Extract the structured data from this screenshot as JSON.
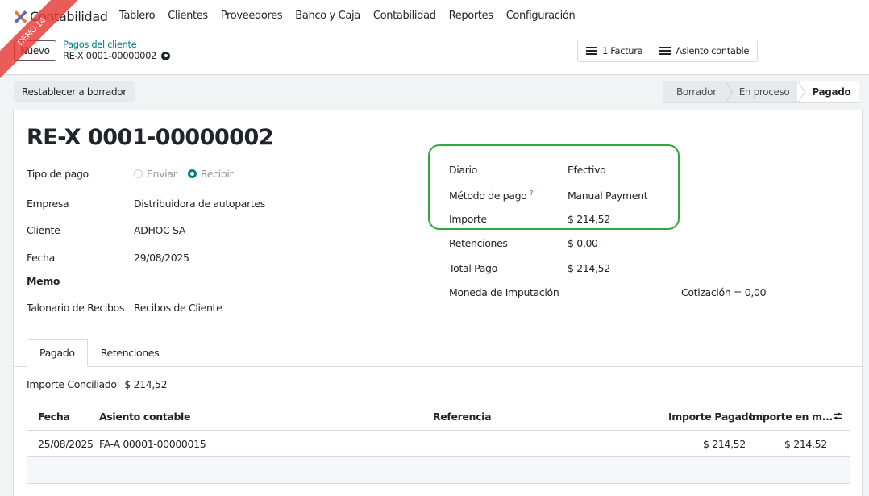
{
  "nav": {
    "app_name": "Contabilidad",
    "menu": [
      "Tablero",
      "Clientes",
      "Proveedores",
      "Banco y Caja",
      "Contabilidad",
      "Reportes",
      "Configuración"
    ],
    "ribbon": "DEMO 14"
  },
  "control": {
    "new_label": "Nuevo",
    "breadcrumb_parent": "Pagos del cliente",
    "breadcrumb_current": "RE-X 0001-00000002",
    "invoice_btn": "1 Factura",
    "entry_btn": "Asiento contable"
  },
  "statusbar": {
    "reset_label": "Restablecer a borrador",
    "steps": [
      "Borrador",
      "En proceso",
      "Pagado"
    ],
    "active_step": "Pagado"
  },
  "form": {
    "title": "RE-X 0001-00000002",
    "left": {
      "tipo_pago_label": "Tipo de pago",
      "tipo_pago_options": [
        "Enviar",
        "Recibir"
      ],
      "tipo_pago_selected": "Recibir",
      "empresa_label": "Empresa",
      "empresa_value": "Distribuidora de autopartes",
      "cliente_label": "Cliente",
      "cliente_value": "ADHOC SA",
      "fecha_label": "Fecha",
      "fecha_value": "29/08/2025",
      "memo_label": "Memo",
      "talonario_label": "Talonario de Recibos",
      "talonario_value": "Recibos de Cliente"
    },
    "right": {
      "diario_label": "Diario",
      "diario_value": "Efectivo",
      "metodo_label": "Método de pago",
      "metodo_help": "?",
      "metodo_value": "Manual Payment",
      "importe_label": "Importe",
      "importe_value": "$ 214,52",
      "retenciones_label": "Retenciones",
      "retenciones_value": "$ 0,00",
      "total_label": "Total Pago",
      "total_value": "$ 214,52",
      "moneda_label": "Moneda de Imputación",
      "cotizacion": "Cotización = 0,00"
    }
  },
  "tabs": [
    "Pagado",
    "Retenciones"
  ],
  "tab_active": "Pagado",
  "conciliado": {
    "label": "Importe Conciliado",
    "value": "$ 214,52"
  },
  "table": {
    "headers": [
      "Fecha",
      "Asiento contable",
      "Referencia",
      "Importe Pagado",
      "Importe en m..."
    ],
    "rows": [
      [
        "25/08/2025",
        "FA-A 00001-00000015",
        "",
        "$ 214,52",
        "$ 214,52"
      ]
    ]
  },
  "colors": {
    "accent": "#017e84",
    "brand": "#714b67",
    "highlight": "#2eaa3a",
    "ribbon": "#e53935"
  }
}
